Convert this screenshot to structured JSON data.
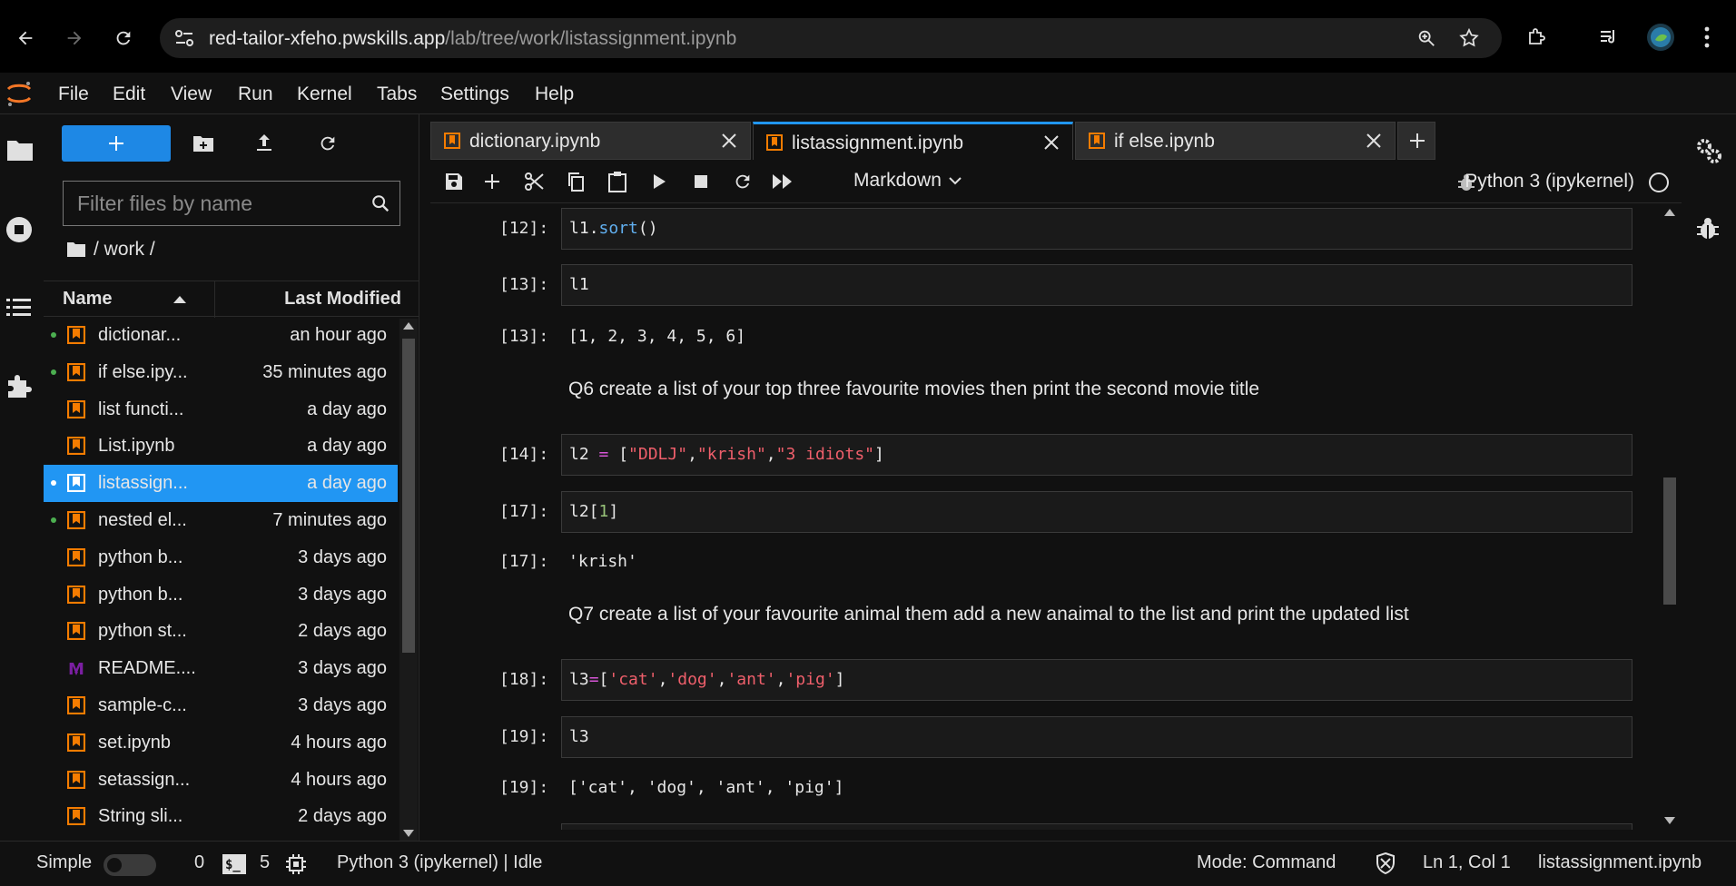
{
  "browser": {
    "url_host": "red-tailor-xfeho.pwskills.app",
    "url_path": "/lab/tree/work/listassignment.ipynb"
  },
  "menu": [
    "File",
    "Edit",
    "View",
    "Run",
    "Kernel",
    "Tabs",
    "Settings",
    "Help"
  ],
  "filebrowser": {
    "filter_placeholder": "Filter files by name",
    "breadcrumb": "/ work /",
    "col_name": "Name",
    "col_modified": "Last Modified",
    "files": [
      {
        "name": "dictionar...",
        "modified": "an hour ago",
        "running": true,
        "type": "notebook"
      },
      {
        "name": "if else.ipy...",
        "modified": "35 minutes ago",
        "running": true,
        "type": "notebook"
      },
      {
        "name": "list functi...",
        "modified": "a day ago",
        "running": false,
        "type": "notebook"
      },
      {
        "name": "List.ipynb",
        "modified": "a day ago",
        "running": false,
        "type": "notebook"
      },
      {
        "name": "listassign...",
        "modified": "a day ago",
        "running": true,
        "type": "notebook",
        "selected": true
      },
      {
        "name": "nested el...",
        "modified": "7 minutes ago",
        "running": true,
        "type": "notebook"
      },
      {
        "name": "python b...",
        "modified": "3 days ago",
        "running": false,
        "type": "notebook"
      },
      {
        "name": "python b...",
        "modified": "3 days ago",
        "running": false,
        "type": "notebook"
      },
      {
        "name": "python st...",
        "modified": "2 days ago",
        "running": false,
        "type": "notebook"
      },
      {
        "name": "README....",
        "modified": "3 days ago",
        "running": false,
        "type": "markdown"
      },
      {
        "name": "sample-c...",
        "modified": "3 days ago",
        "running": false,
        "type": "notebook"
      },
      {
        "name": "set.ipynb",
        "modified": "4 hours ago",
        "running": false,
        "type": "notebook"
      },
      {
        "name": "setassign...",
        "modified": "4 hours ago",
        "running": false,
        "type": "notebook"
      },
      {
        "name": "String sli...",
        "modified": "2 days ago",
        "running": false,
        "type": "notebook"
      }
    ]
  },
  "tabs": [
    {
      "label": "dictionary.ipynb",
      "active": false
    },
    {
      "label": "listassignment.ipynb",
      "active": true
    },
    {
      "label": "if else.ipynb",
      "active": false
    }
  ],
  "toolbar": {
    "cell_type": "Markdown",
    "kernel": "Python 3 (ipykernel)"
  },
  "cells": {
    "c12_prompt": "[12]:",
    "c12_code": {
      "a": "l1",
      "b": ".",
      "c": "sort",
      "d": "()"
    },
    "c13_prompt": "[13]:",
    "c13_code": "l1",
    "c13_out_prompt": "[13]:",
    "c13_out": "[1, 2, 3, 4, 5, 6]",
    "md_q6": "Q6 create a list of your top three favourite movies then print the second movie title",
    "c14_prompt": "[14]:",
    "c14_code": {
      "a": "l2 ",
      "b": "=",
      "c": " [",
      "d": "\"DDLJ\"",
      "e": ",",
      "f": "\"krish\"",
      "g": ",",
      "h": "\"3 idiots\"",
      "i": "]"
    },
    "c17_prompt": "[17]:",
    "c17_code": {
      "a": "l2[",
      "b": "1",
      "c": "]"
    },
    "c17_out_prompt": "[17]:",
    "c17_out": "'krish'",
    "md_q7": "Q7 create a list of your favourite animal them add a new anaimal to the list and print the updated list",
    "c18_prompt": "[18]:",
    "c18_code": {
      "a": "l3",
      "b": "=",
      "c": "[",
      "d": "'cat'",
      "e": ",",
      "f": "'dog'",
      "g": ",",
      "h": "'ant'",
      "i": ",",
      "j": "'pig'",
      "k": "]"
    },
    "c19_prompt": "[19]:",
    "c19_code": "l3",
    "c19_out_prompt": "[19]:",
    "c19_out": "['cat', 'dog', 'ant', 'pig']"
  },
  "statusbar": {
    "simple_label": "Simple",
    "terminals_count": "0",
    "kernels_count": "5",
    "kernel_status": "Python 3 (ipykernel) | Idle",
    "mode": "Mode: Command",
    "position": "Ln 1, Col 1",
    "filename": "listassignment.ipynb"
  },
  "colors": {
    "accent": "#2196f3",
    "notebook_icon": "#f57c00",
    "markdown_icon": "#7b1fa2",
    "running_dot": "#4caf50"
  }
}
